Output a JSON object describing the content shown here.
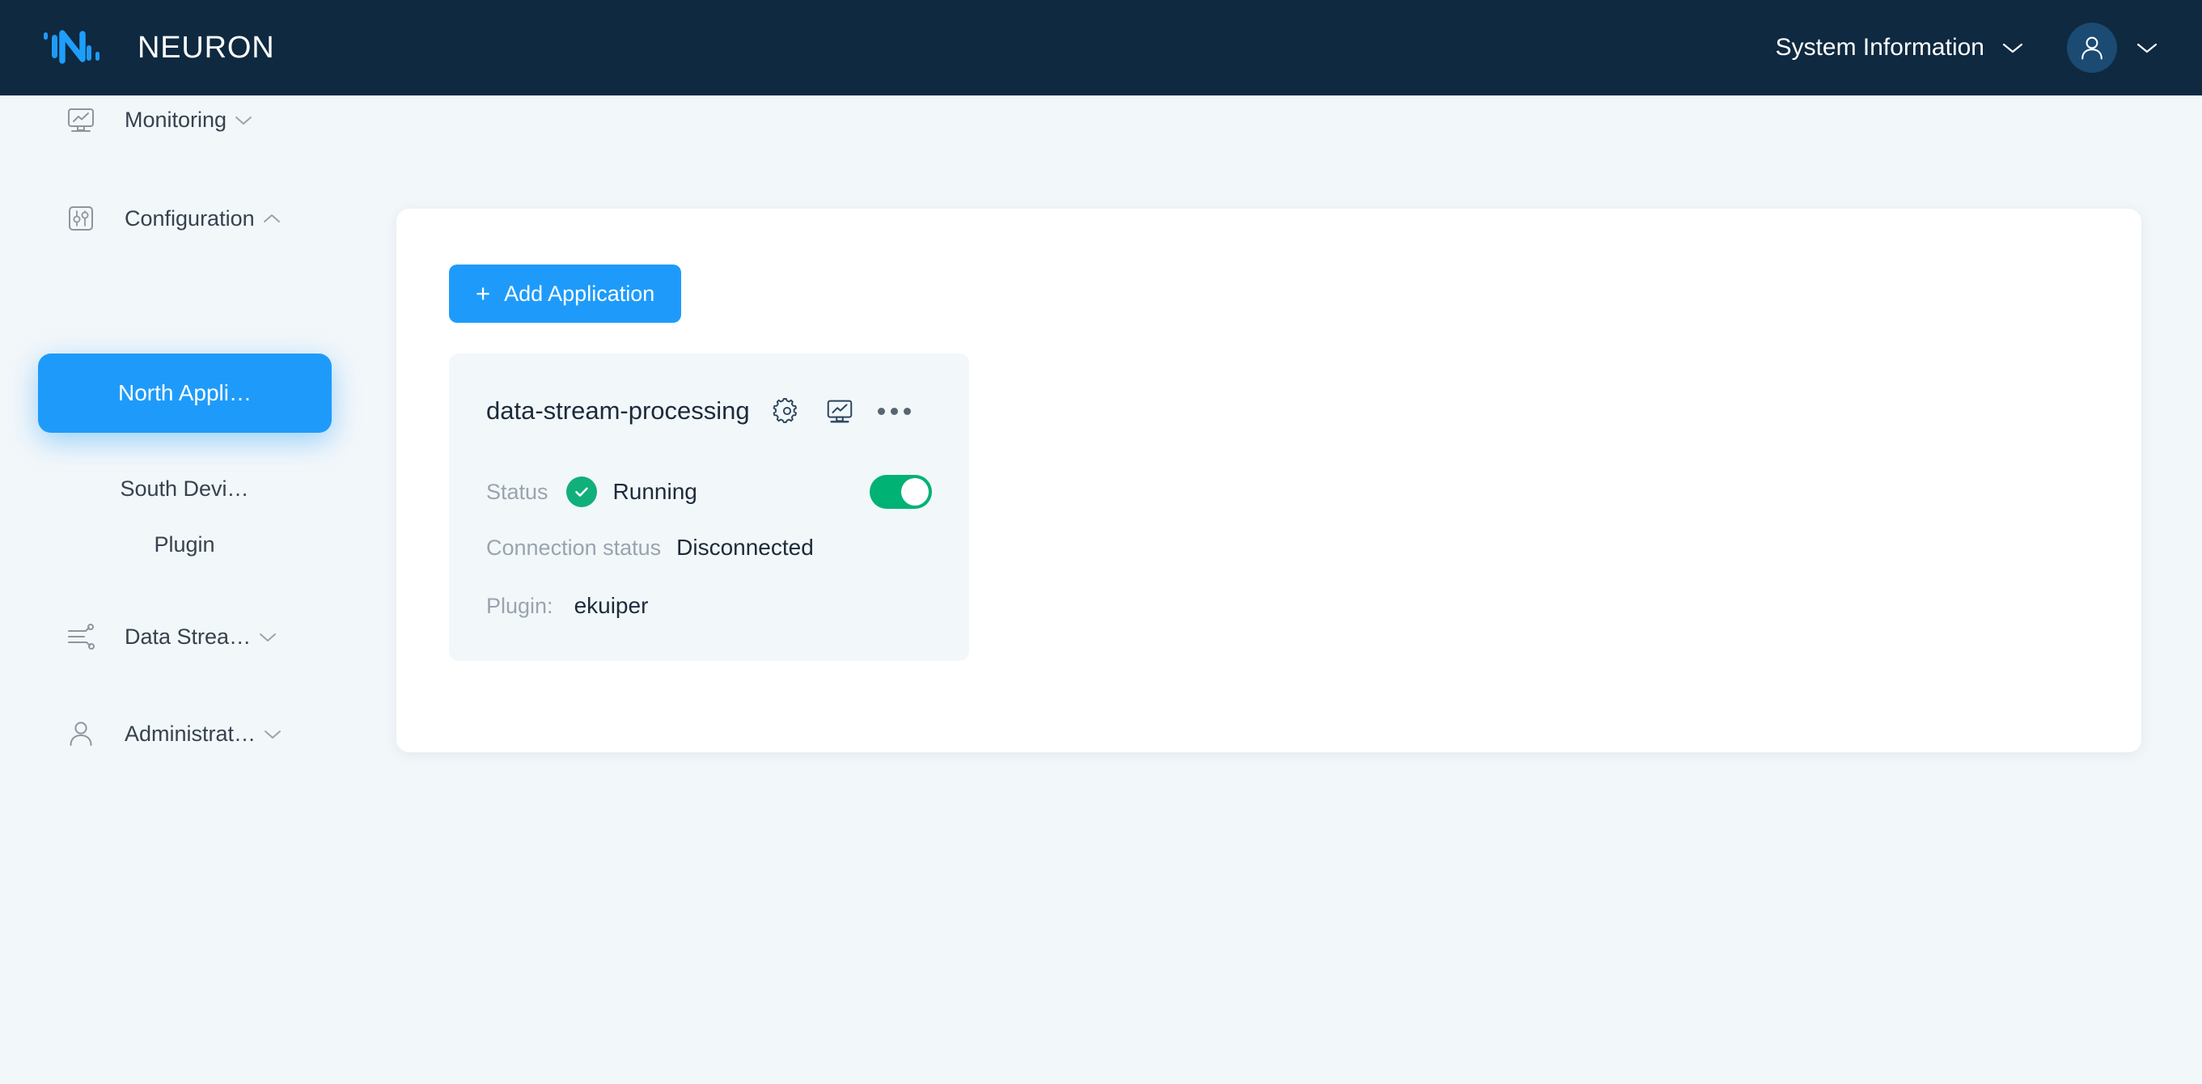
{
  "header": {
    "brand_name": "NEURON",
    "logo_icon": "neuron-logo-icon",
    "system_info_label": "System Information",
    "system_info_caret_icon": "chevron-down-icon",
    "avatar_icon": "user-avatar-icon",
    "avatar_caret_icon": "chevron-down-icon",
    "background_color": "#0e2940"
  },
  "sidebar": {
    "items": [
      {
        "label": "Monitoring",
        "icon": "monitor-chart-icon",
        "caret_icon": "chevron-down-icon",
        "expanded": false
      },
      {
        "label": "Configuration",
        "icon": "sliders-icon",
        "caret_icon": "chevron-up-icon",
        "expanded": true
      },
      {
        "label": "North Appli…",
        "icon": "",
        "active": true
      },
      {
        "label": "South Devi…",
        "icon": "",
        "active": false
      },
      {
        "label": "Plugin",
        "icon": "",
        "active": false
      },
      {
        "label": "Data Strea…",
        "icon": "data-stream-icon",
        "caret_icon": "chevron-down-icon",
        "expanded": false
      },
      {
        "label": "Administrat…",
        "icon": "user-icon",
        "caret_icon": "chevron-down-icon",
        "expanded": false
      }
    ],
    "active_color": "#1e9bfa"
  },
  "main": {
    "add_application_label": "Add Application",
    "add_application_plus": "+",
    "cards": [
      {
        "name": "data-stream-processing",
        "settings_icon": "gear-icon",
        "monitor_icon": "monitor-chart-icon",
        "more_icon": "ellipsis-icon",
        "status_label": "Status",
        "status_value": "Running",
        "status_icon": "check-circle-icon",
        "status_color": "#11b07a",
        "toggle_on": true,
        "connection_label": "Connection status",
        "connection_value": "Disconnected",
        "plugin_label": "Plugin:",
        "plugin_value": "ekuiper"
      }
    ]
  },
  "colors": {
    "page_background": "#f2f7fa",
    "panel_background": "#ffffff",
    "accent_blue": "#1e9bfa",
    "accent_green": "#00b274",
    "header_navy": "#0e2940"
  }
}
